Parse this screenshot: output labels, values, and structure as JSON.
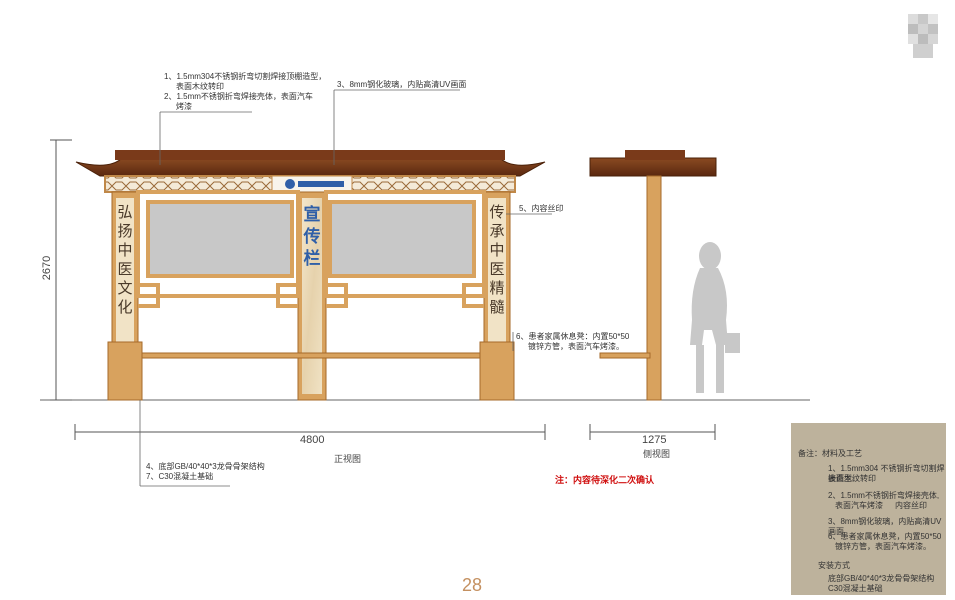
{
  "notes": {
    "note1_line1": "1、1.5mm304不锈钢折弯切割焊接顶棚造型，",
    "note1_line2": "表面木纹转印",
    "note2_line1": "2、1.5mm不锈钢折弯焊接壳体，表面汽车",
    "note2_line2": "烤漆",
    "note3": "3、8mm钢化玻璃，内贴高清UV画面",
    "note5": "5、内容丝印",
    "note6_line1": "6、患者家属休息凳：内置50*50",
    "note6_line2": "镀锌方管，表面汽车烤漆。",
    "note4": "4、底部GB/40*40*3龙骨骨架结构",
    "note7": "7、C30混凝土基础"
  },
  "dimensions": {
    "height": "2670",
    "width_front": "4800",
    "width_side": "1275"
  },
  "captions": {
    "front_view": "正视图",
    "side_view": "侧视图"
  },
  "red_note": "注：内容待深化二次确认",
  "panel_text": {
    "left_column": [
      "弘",
      "扬",
      "中",
      "医",
      "文",
      "化"
    ],
    "right_column": [
      "传",
      "承",
      "中",
      "医",
      "精",
      "髓"
    ],
    "center_column": [
      "宣",
      "传",
      "栏"
    ]
  },
  "legend": {
    "title": "备注：材料及工艺",
    "items": [
      "1、1.5mm304 不锈钢折弯切割焊接造型,",
      "表面木纹转印",
      "2、1.5mm不锈钢折弯焊接壳体,",
      "表面汽车烤漆",
      "内容丝印",
      "3、8mm钢化玻璃，内贴高清UV画面",
      "6、患者家属休息凳，内置50*50",
      "镀锌方管，表面汽车烤漆。"
    ],
    "install_title": "安装方式",
    "install_items": [
      "底部GB/40*40*3龙骨骨架结构",
      "C30混凝土基础"
    ]
  },
  "page_number": "28",
  "colors": {
    "wood_frame": "#d8a25e",
    "dark_wood": "#7a3a1a",
    "glass_panel": "#c8c8c8",
    "legend_bg": "#bdb29c",
    "page_number": "#c49060"
  }
}
